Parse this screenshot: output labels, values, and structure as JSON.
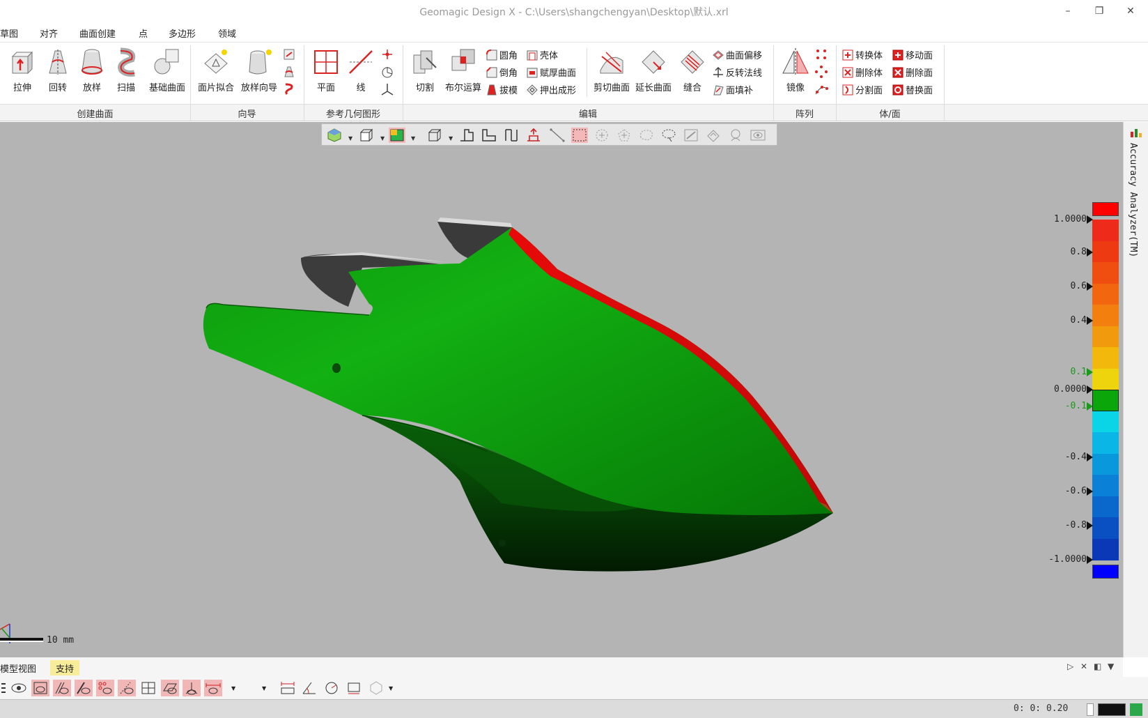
{
  "window": {
    "title": "Geomagic Design X - C:\\Users\\shangchengyan\\Desktop\\默认.xrl",
    "minimize": "–",
    "restore": "❐",
    "close": "✕"
  },
  "menu": [
    "草图",
    "对齐",
    "曲面创建",
    "点",
    "多边形",
    "领域"
  ],
  "ribbon": {
    "groups": [
      "创建曲面",
      "向导",
      "参考几何图形",
      "编辑",
      "阵列",
      "体/面"
    ],
    "create_surface": [
      "拉伸",
      "回转",
      "放样",
      "扫描",
      "基础曲面"
    ],
    "wizard": [
      "面片拟合",
      "放样向导"
    ],
    "ref_geometry": [
      "平面",
      "线"
    ],
    "edit_big": [
      "切割",
      "布尔运算"
    ],
    "edit_small_col1": [
      "圆角",
      "倒角",
      "拔模"
    ],
    "edit_small_col2": [
      "壳体",
      "赋厚曲面",
      "押出成形"
    ],
    "edit_big2": [
      "剪切曲面",
      "延长曲面",
      "缝合"
    ],
    "edit_small_col3": [
      "曲面偏移",
      "反转法线",
      "面填补"
    ],
    "pattern": [
      "镜像"
    ],
    "body_face_col1": [
      "转换体",
      "删除体",
      "分割面"
    ],
    "body_face_col2": [
      "移动面",
      "删除面",
      "替换面"
    ]
  },
  "colorbar": {
    "title": "Accuracy Analyzer(TM)",
    "labels": [
      "1.0000",
      "0.8",
      "0.6",
      "0.4",
      "0.1",
      "0.0000",
      "-0.1",
      "-0.4",
      "-0.6",
      "-0.8",
      "-1.0000"
    ],
    "colors": [
      "#ee2b1b",
      "#ee3a12",
      "#f04e10",
      "#f2660f",
      "#f3800e",
      "#f29a0d",
      "#f2b80c",
      "#eed40c",
      "#0aa60a",
      "#0ad5e6",
      "#0ab6e6",
      "#0a98dd",
      "#0a80d6",
      "#0a68cc",
      "#0a50c2",
      "#0a38b6"
    ],
    "over_color": "#ff0000",
    "under_color": "#0000ff",
    "in_tolerance_color": "#0aa60a"
  },
  "scale": {
    "label": "10 mm"
  },
  "bottom": {
    "tabs": [
      "模型视图",
      "支持"
    ]
  },
  "status": {
    "coords": "0: 0: 0.20"
  }
}
